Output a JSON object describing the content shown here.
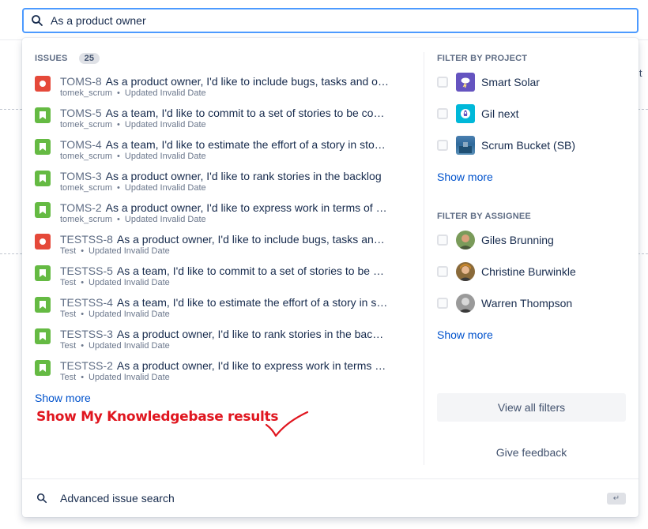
{
  "search": {
    "value": "As a product owner",
    "placeholder": ""
  },
  "background": {
    "fragment": "it"
  },
  "issues": {
    "heading": "ISSUES",
    "count": "25",
    "items": [
      {
        "type": "bug",
        "key": "TOMS-8",
        "summary": "As a product owner, I'd like to include bugs, tasks and other issue types in my backlog",
        "project": "tomek_scrum",
        "separator": "•",
        "updated": "Updated Invalid Date"
      },
      {
        "type": "story",
        "key": "TOMS-5",
        "summary": "As a team, I'd like to commit to a set of stories to be completed in a sprint",
        "project": "tomek_scrum",
        "separator": "•",
        "updated": "Updated Invalid Date"
      },
      {
        "type": "story",
        "key": "TOMS-4",
        "summary": "As a team, I'd like to estimate the effort of a story in story points",
        "project": "tomek_scrum",
        "separator": "•",
        "updated": "Updated Invalid Date"
      },
      {
        "type": "story",
        "key": "TOMS-3",
        "summary": "As a product owner, I'd like to rank stories in the backlog",
        "project": "tomek_scrum",
        "separator": "•",
        "updated": "Updated Invalid Date"
      },
      {
        "type": "story",
        "key": "TOMS-2",
        "summary": "As a product owner, I'd like to express work in terms of actual user problems",
        "project": "tomek_scrum",
        "separator": "•",
        "updated": "Updated Invalid Date"
      },
      {
        "type": "bug",
        "key": "TESTSS-8",
        "summary": "As a product owner, I'd like to include bugs, tasks and other issue types in my backlog",
        "project": "Test",
        "separator": "•",
        "updated": "Updated Invalid Date"
      },
      {
        "type": "story",
        "key": "TESTSS-5",
        "summary": "As a team, I'd like to commit to a set of stories to be completed in a sprint",
        "project": "Test",
        "separator": "•",
        "updated": "Updated Invalid Date"
      },
      {
        "type": "story",
        "key": "TESTSS-4",
        "summary": "As a team, I'd like to estimate the effort of a story in story points",
        "project": "Test",
        "separator": "•",
        "updated": "Updated Invalid Date"
      },
      {
        "type": "story",
        "key": "TESTSS-3",
        "summary": "As a product owner, I'd like to rank stories in the backlog",
        "project": "Test",
        "separator": "•",
        "updated": "Updated Invalid Date"
      },
      {
        "type": "story",
        "key": "TESTSS-2",
        "summary": "As a product owner, I'd like to express work in terms of actual user problems",
        "project": "Test",
        "separator": "•",
        "updated": "Updated Invalid Date"
      }
    ],
    "show_more": "Show more"
  },
  "annotation": {
    "text": "Show My Knowledgebase results",
    "color": "#e0161f"
  },
  "filters": {
    "project_heading": "FILTER BY PROJECT",
    "projects": [
      {
        "name": "Smart Solar",
        "icon": "cloud-bolt-icon",
        "color": "#6554c0"
      },
      {
        "name": "Gil next",
        "icon": "rocket-icon",
        "color": "#00b8d9"
      },
      {
        "name": "Scrum Bucket (SB)",
        "icon": "photo-icon",
        "color": "#2684ff"
      }
    ],
    "project_show_more": "Show more",
    "assignee_heading": "FILTER BY ASSIGNEE",
    "assignees": [
      {
        "name": "Giles Brunning",
        "icon": "avatar-icon"
      },
      {
        "name": "Christine Burwinkle",
        "icon": "avatar-icon"
      },
      {
        "name": "Warren Thompson",
        "icon": "avatar-icon"
      }
    ],
    "assignee_show_more": "Show more",
    "view_all": "View all filters",
    "feedback": "Give feedback"
  },
  "footer": {
    "label": "Advanced issue search",
    "enter_glyph": "↵"
  },
  "colors": {
    "accent": "#0052cc",
    "focus": "#4c9aff",
    "bug": "#e5493a",
    "story": "#65ba43"
  }
}
